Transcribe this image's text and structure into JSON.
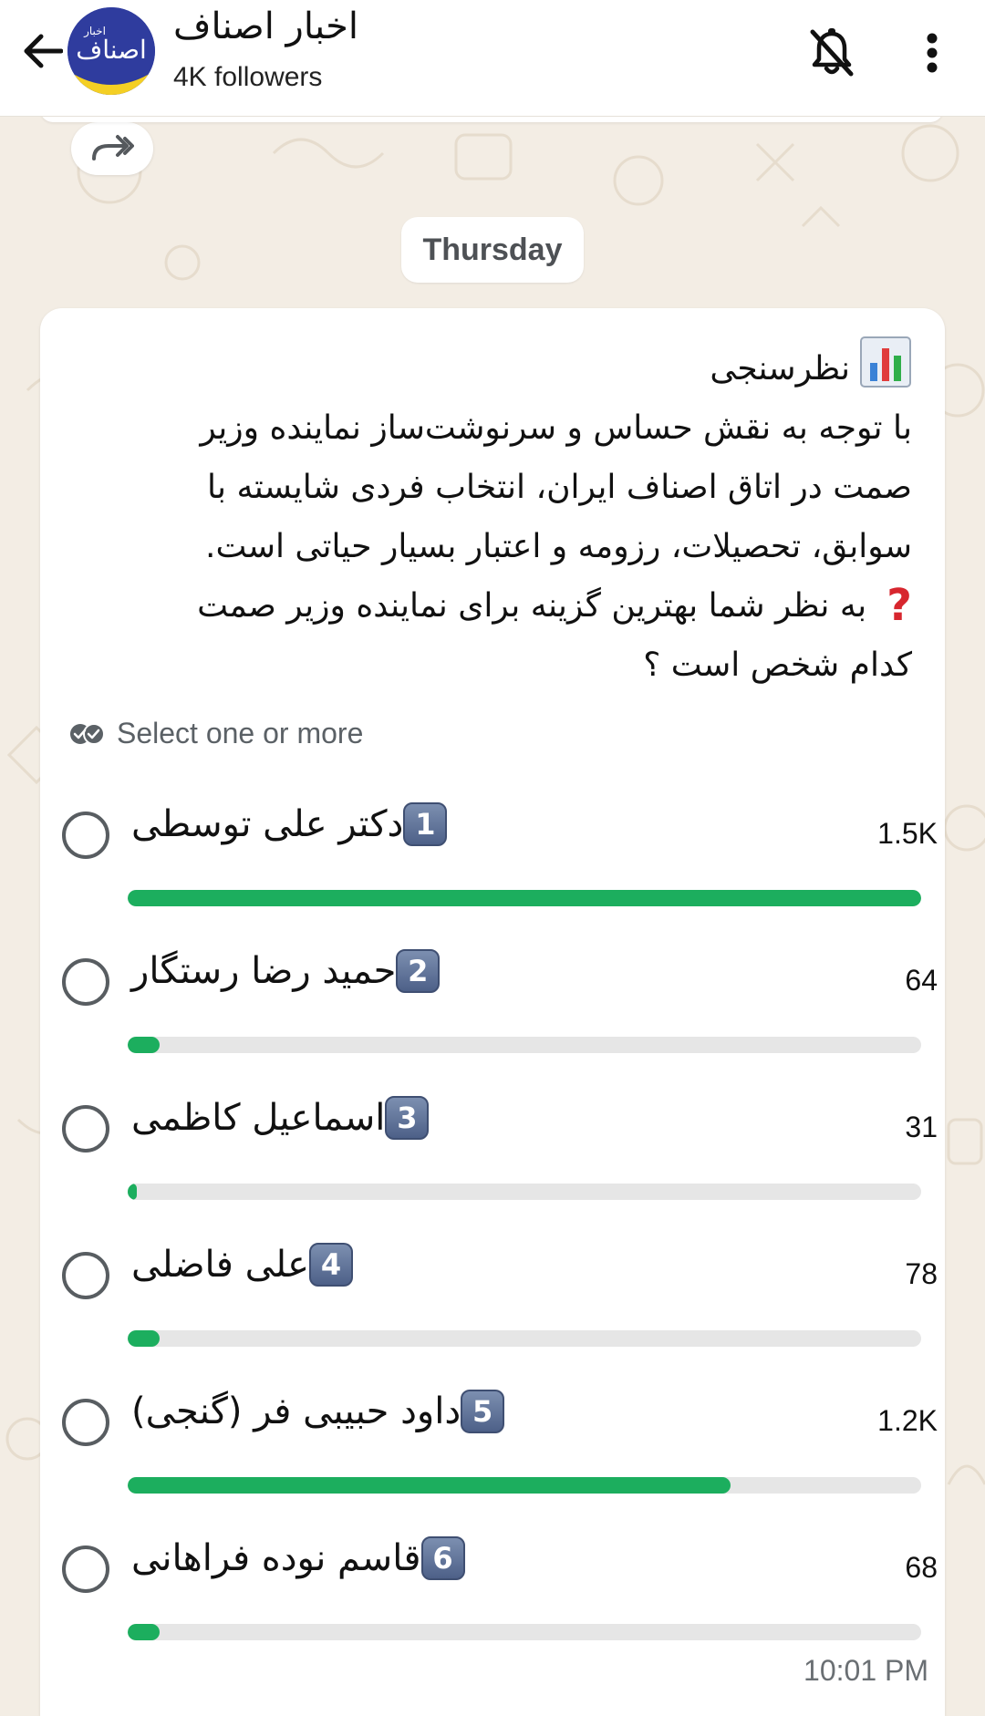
{
  "header": {
    "channel_name": "اخبار اصناف",
    "followers": "4K followers",
    "avatar_text": "اصناف",
    "avatar_subtext": "اخبار"
  },
  "date_chip": "Thursday",
  "poll": {
    "title": "نظرسنجی",
    "question_lines": [
      "با توجه به نقش حساس و سرنوشت‌ساز نماینده وزیر",
      "صمت در اتاق اصناف ایران، انتخاب فردی شایسته با",
      "سوابق، تحصیلات، رزومه و اعتبار بسیار حیاتی است.",
      "به نظر شما بهترین گزینه برای نماینده وزیر صمت",
      "کدام شخص است ؟"
    ],
    "select_hint": "Select one or more",
    "options": [
      {
        "number": "1",
        "label": "دکتر علی توسطی",
        "count": "1.5K",
        "share": 1.0
      },
      {
        "number": "2",
        "label": "حمید رضا رستگار",
        "count": "64",
        "share": 0.04
      },
      {
        "number": "3",
        "label": "اسماعیل کاظمی",
        "count": "31",
        "share": 0.01
      },
      {
        "number": "4",
        "label": "علی فاضلی",
        "count": "78",
        "share": 0.04
      },
      {
        "number": "5",
        "label": "داود حبیبی فر (گنجی)",
        "count": "1.2K",
        "share": 0.76
      },
      {
        "number": "6",
        "label": "قاسم نوده فراهانی",
        "count": "68",
        "share": 0.04
      }
    ],
    "time": "10:01 PM"
  },
  "icons": {
    "back": "arrow-left-icon",
    "bell": "bell-off-icon",
    "more": "more-vertical-icon",
    "forward": "forward-icon",
    "double_check": "double-check-icon",
    "chart": "bar-chart-emoji",
    "question": "red-question-mark-emoji"
  },
  "colors": {
    "bar_fill": "#1cae5e",
    "bar_track": "#e6e6e6",
    "background": "#f3ede4"
  }
}
